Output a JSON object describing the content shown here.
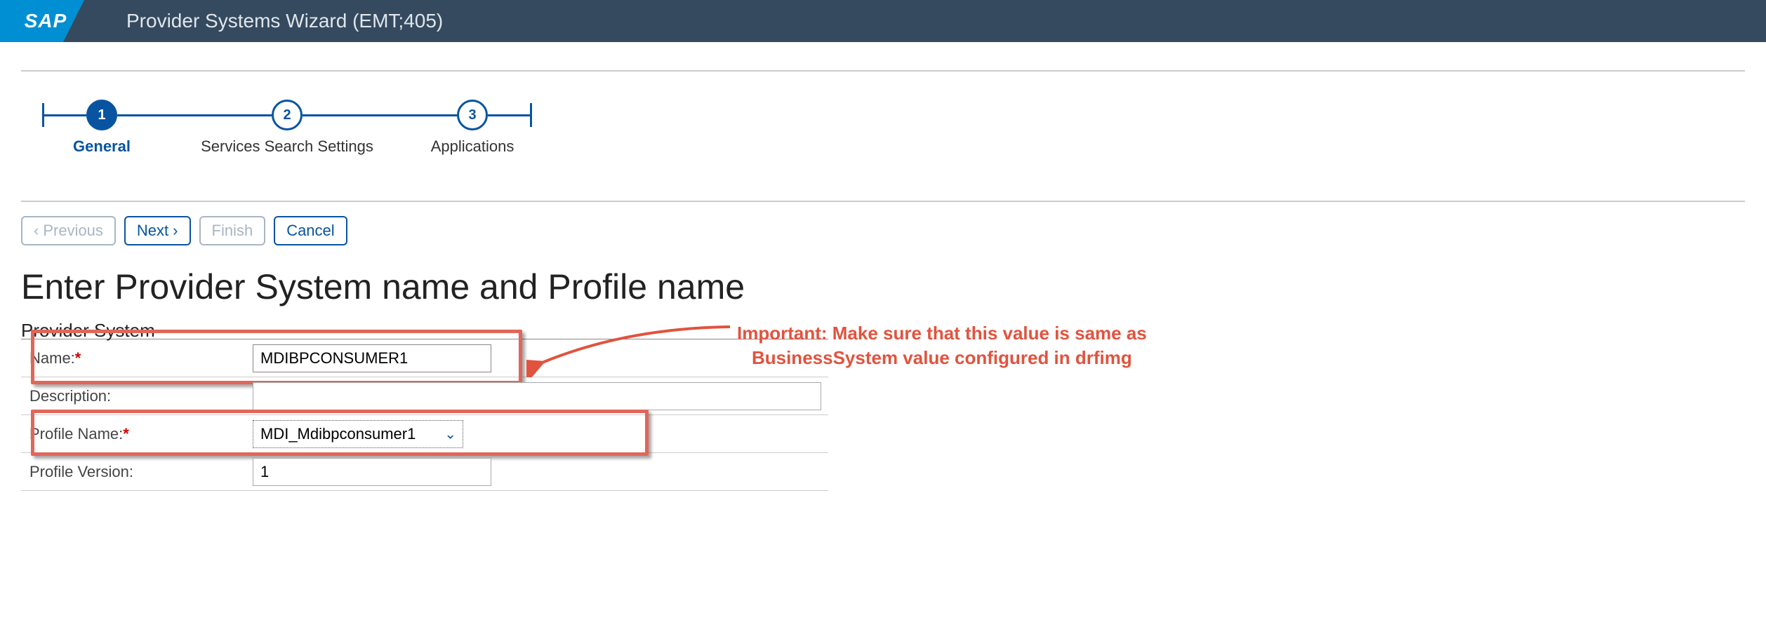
{
  "header": {
    "logo_text": "SAP",
    "title": "Provider Systems Wizard (EMT;405)"
  },
  "wizard": {
    "steps": [
      {
        "num": "1",
        "label": "General"
      },
      {
        "num": "2",
        "label": "Services Search Settings"
      },
      {
        "num": "3",
        "label": "Applications"
      }
    ]
  },
  "buttons": {
    "previous": "Previous",
    "next": "Next",
    "finish": "Finish",
    "cancel": "Cancel"
  },
  "page_title": "Enter Provider System name and Profile name",
  "section_title": "Provider System",
  "form": {
    "name_label": "Name:",
    "name_value": "MDIBPCONSUMER1",
    "desc_label": "Description:",
    "desc_value": "",
    "profile_name_label": "Profile Name:",
    "profile_name_value": "MDI_Mdibpconsumer1",
    "profile_version_label": "Profile Version:",
    "profile_version_value": "1"
  },
  "annotation": {
    "line1": "Important: Make sure that this value is same as",
    "line2": "BusinessSystem value configured in drfimg"
  }
}
